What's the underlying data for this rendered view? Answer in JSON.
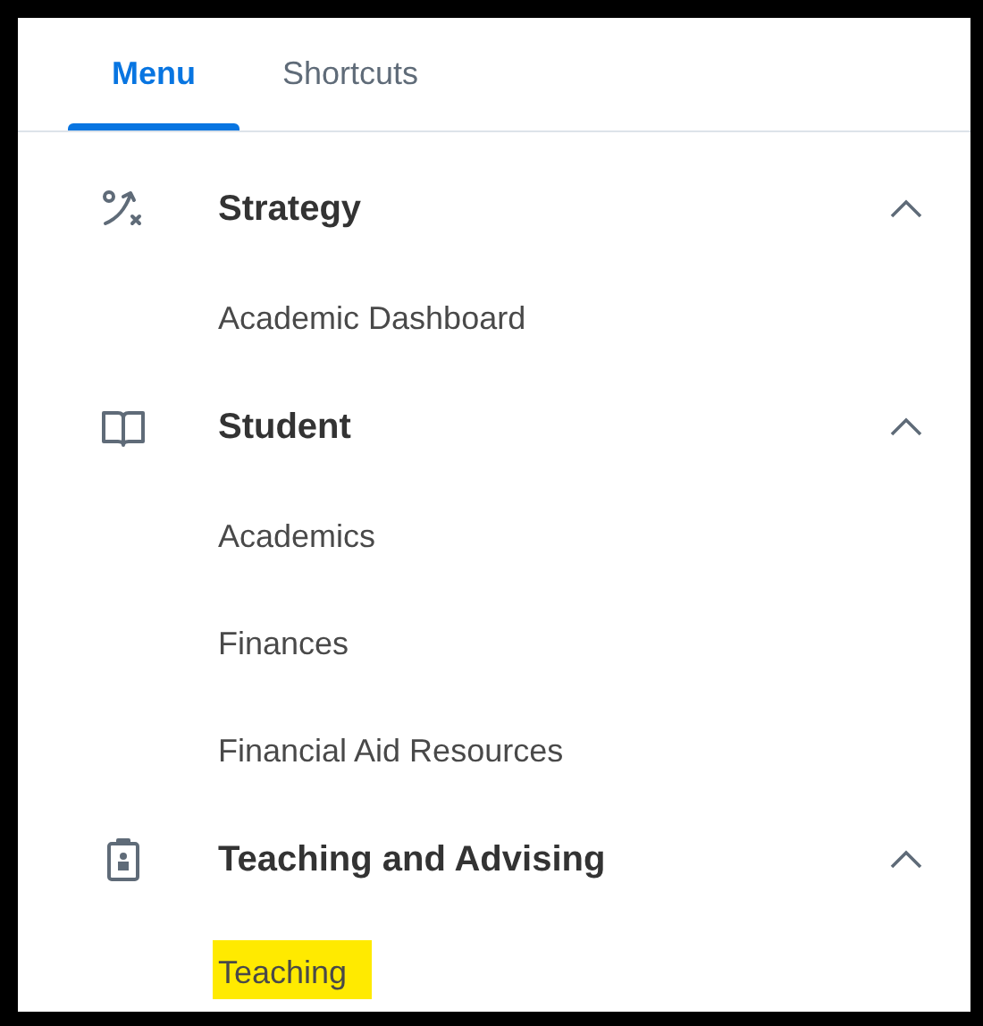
{
  "tabs": [
    {
      "label": "Menu",
      "selected": true
    },
    {
      "label": "Shortcuts",
      "selected": false
    }
  ],
  "sections": [
    {
      "title": "Strategy",
      "expanded": true,
      "items": [
        {
          "label": "Academic Dashboard",
          "highlighted": false
        }
      ]
    },
    {
      "title": "Student",
      "expanded": true,
      "items": [
        {
          "label": "Academics",
          "highlighted": false
        },
        {
          "label": "Finances",
          "highlighted": false
        },
        {
          "label": "Financial Aid Resources",
          "highlighted": false
        }
      ]
    },
    {
      "title": "Teaching and Advising",
      "expanded": true,
      "items": [
        {
          "label": "Teaching",
          "highlighted": true
        }
      ]
    }
  ]
}
